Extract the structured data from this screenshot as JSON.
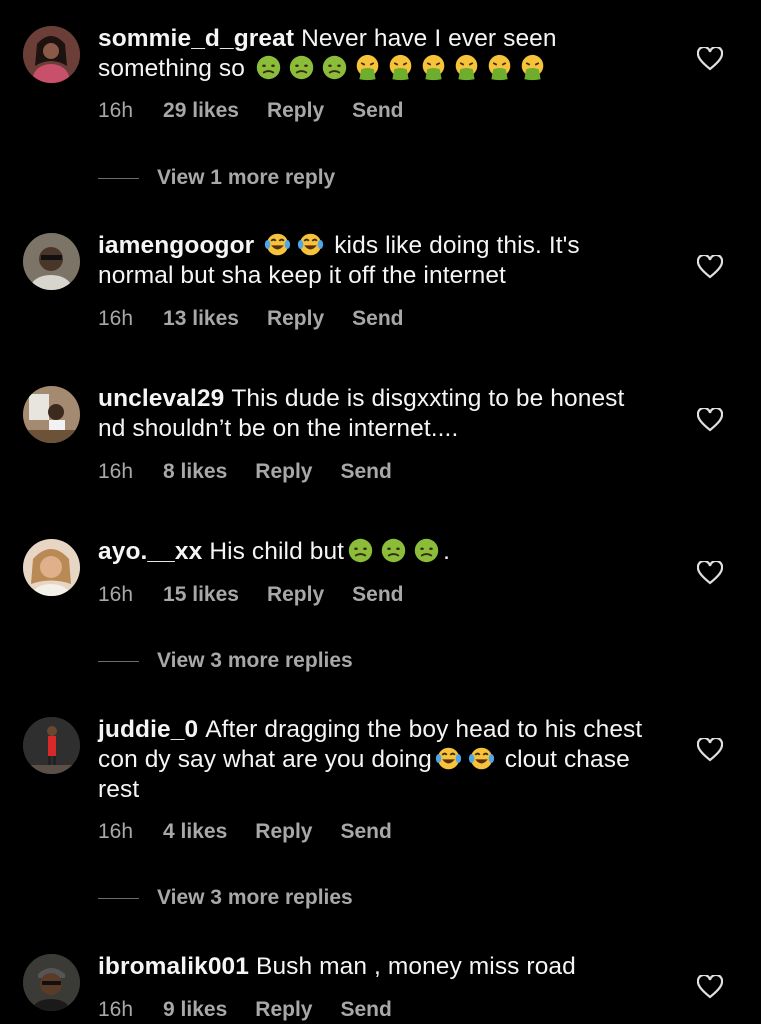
{
  "comments": [
    {
      "username": "sommie_d_great",
      "text": "Never have I ever seen something so",
      "emojis": [
        "nauseated",
        "nauseated",
        "nauseated",
        "vomiting",
        "vomiting",
        "vomiting",
        "vomiting",
        "vomiting",
        "vomiting"
      ],
      "time": "16h",
      "likes": "29 likes",
      "reply": "Reply",
      "send": "Send",
      "view_more": "View 1 more reply",
      "avatar": "#7a4d45"
    },
    {
      "username": "iamengoogor",
      "emojis_inline": [
        "tears-of-joy",
        "tears-of-joy"
      ],
      "text": "kids like doing this. It's normal but sha keep it off the internet",
      "time": "16h",
      "likes": "13 likes",
      "reply": "Reply",
      "send": "Send",
      "avatar": "#5b5148"
    },
    {
      "username": "uncleval29",
      "text": "This dude is disgxxting to be honest nd shouldn’t be on the internet....",
      "time": "16h",
      "likes": "8 likes",
      "reply": "Reply",
      "send": "Send",
      "avatar": "#8a7560"
    },
    {
      "username": "ayo.__xx",
      "text": "His child but",
      "emojis": [
        "nauseated",
        "nauseated",
        "nauseated"
      ],
      "text_after": ".",
      "time": "16h",
      "likes": "15 likes",
      "reply": "Reply",
      "send": "Send",
      "view_more": "View 3 more replies",
      "avatar": "#c9a98a"
    },
    {
      "username": "juddie_0",
      "text": "After dragging the boy head to his chest con dy say what are you doing",
      "emojis": [
        "tears-of-joy",
        "tears-of-joy"
      ],
      "text_after": "clout chase rest",
      "time": "16h",
      "likes": "4 likes",
      "reply": "Reply",
      "send": "Send",
      "view_more": "View 3 more replies",
      "avatar": "#3c3c3c"
    },
    {
      "username": "ibromalik001",
      "text": "Bush man , money miss road",
      "time": "16h",
      "likes": "9 likes",
      "reply": "Reply",
      "send": "Send",
      "avatar": "#4a4a44"
    }
  ]
}
